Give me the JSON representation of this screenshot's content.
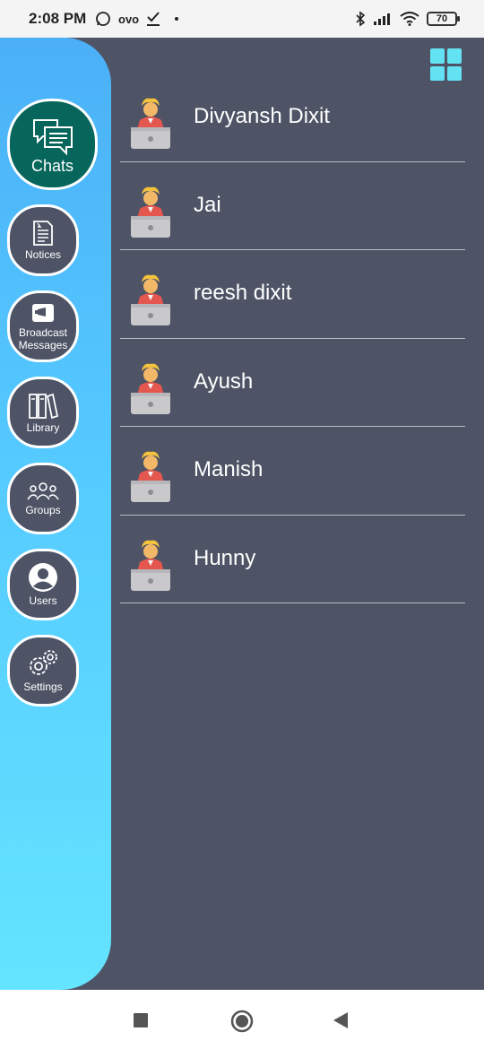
{
  "status_bar": {
    "time": "2:08 PM",
    "ovo": "ovo",
    "battery": "70"
  },
  "sidebar": {
    "items": [
      {
        "label": "Chats",
        "icon": "chat-bubbles-icon",
        "active": true
      },
      {
        "label": "Notices",
        "icon": "document-icon"
      },
      {
        "label": "Broadcast Messages",
        "icon": "broadcast-icon"
      },
      {
        "label": "Library",
        "icon": "books-icon"
      },
      {
        "label": "Groups",
        "icon": "group-icon"
      },
      {
        "label": "Users",
        "icon": "user-circle-icon"
      },
      {
        "label": "Settings",
        "icon": "gear-icon"
      }
    ]
  },
  "chats": [
    {
      "name": "Divyansh Dixit"
    },
    {
      "name": "Jai"
    },
    {
      "name": "reesh dixit"
    },
    {
      "name": "Ayush"
    },
    {
      "name": "Manish"
    },
    {
      "name": "Hunny"
    }
  ],
  "colors": {
    "background": "#4e5466",
    "sidebar_top": "#4bb0f7",
    "sidebar_bottom": "#64e4ff",
    "active_nav": "#07665c",
    "grid_icon": "#63e2f4"
  }
}
